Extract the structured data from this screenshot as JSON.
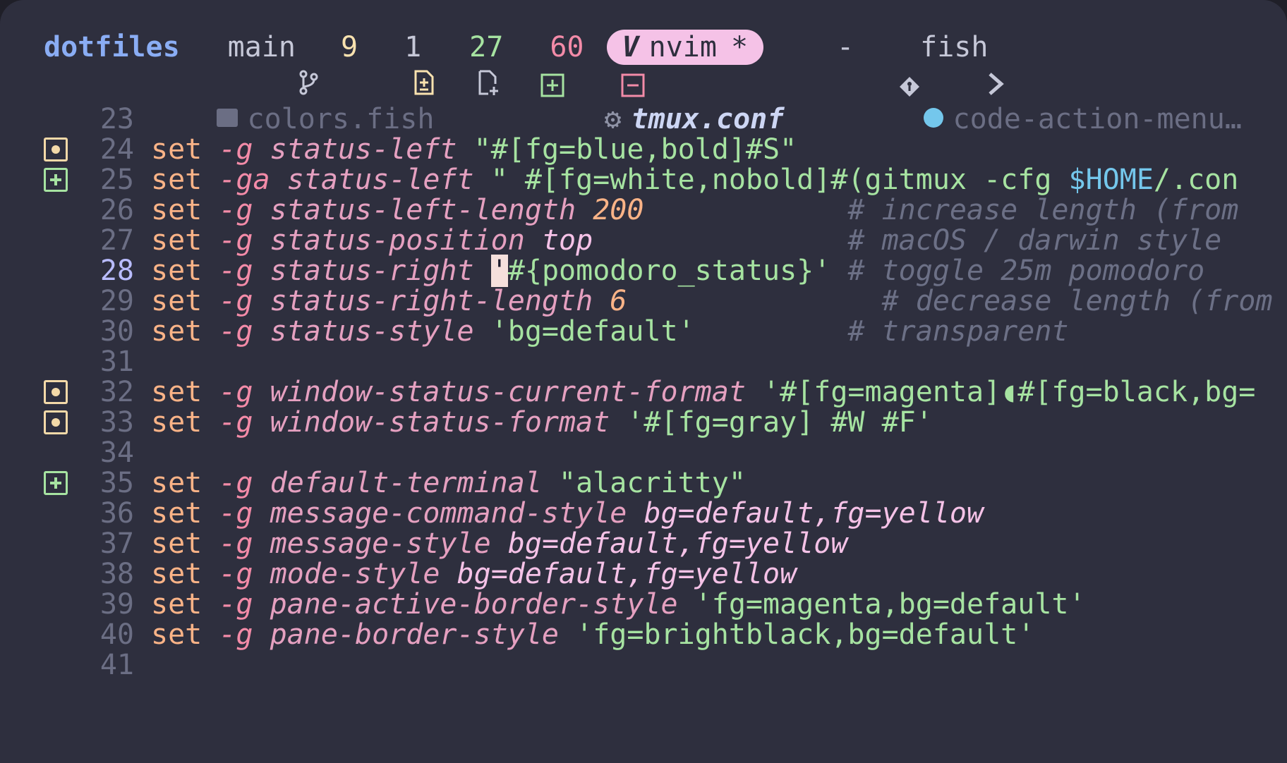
{
  "status": {
    "repo": "dotfiles",
    "branch": "main",
    "staged": "9",
    "untracked": "1",
    "added": "27",
    "removed": "60",
    "mode": "nvim",
    "mode_flag": "*",
    "git_sep": "-",
    "shell": "fish"
  },
  "tabs": [
    {
      "label": "colors.fish",
      "icon": "terminal-icon"
    },
    {
      "label": "tmux.conf",
      "icon": "gear-icon"
    },
    {
      "label": "code-action-menu…",
      "icon": "lua-icon"
    }
  ],
  "colors": {
    "background": "#2e2f3e",
    "keyword": "#fab387",
    "option": "#f38ba8",
    "string": "#a6e3a1",
    "comment": "#6c7086",
    "accent": "#f5c2e7"
  },
  "lines": [
    {
      "n": "23",
      "tokens": []
    },
    {
      "n": "24",
      "mark": "mod",
      "tokens": [
        [
          "kw",
          "set"
        ],
        [
          "t",
          " "
        ],
        [
          "fl",
          "-g"
        ],
        [
          "t",
          " "
        ],
        [
          "opt",
          "status-left"
        ],
        [
          "t",
          " "
        ],
        [
          "str",
          "\"#[fg=blue,bold]#S\""
        ]
      ]
    },
    {
      "n": "25",
      "mark": "add",
      "tokens": [
        [
          "kw",
          "set"
        ],
        [
          "t",
          " "
        ],
        [
          "fl",
          "-ga"
        ],
        [
          "t",
          " "
        ],
        [
          "opt",
          "status-left"
        ],
        [
          "t",
          " "
        ],
        [
          "str",
          "\" #[fg=white,nobold]#(gitmux -cfg "
        ],
        [
          "var",
          "$HOME"
        ],
        [
          "str",
          "/.con"
        ]
      ]
    },
    {
      "n": "26",
      "tokens": [
        [
          "kw",
          "set"
        ],
        [
          "t",
          " "
        ],
        [
          "fl",
          "-g"
        ],
        [
          "t",
          " "
        ],
        [
          "opt",
          "status-left-length"
        ],
        [
          "t",
          " "
        ],
        [
          "num",
          "200"
        ],
        [
          "t",
          "            "
        ],
        [
          "cmt",
          "# increase length (from"
        ]
      ]
    },
    {
      "n": "27",
      "tokens": [
        [
          "kw",
          "set"
        ],
        [
          "t",
          " "
        ],
        [
          "fl",
          "-g"
        ],
        [
          "t",
          " "
        ],
        [
          "opt",
          "status-position"
        ],
        [
          "t",
          " "
        ],
        [
          "val",
          "top"
        ],
        [
          "t",
          "               "
        ],
        [
          "cmt",
          "# macOS / darwin style"
        ]
      ]
    },
    {
      "n": "28",
      "current": true,
      "tokens": [
        [
          "kw",
          "set"
        ],
        [
          "t",
          " "
        ],
        [
          "fl",
          "-g"
        ],
        [
          "t",
          " "
        ],
        [
          "opt",
          "status-right"
        ],
        [
          "t",
          " "
        ],
        [
          "cur",
          "'"
        ],
        [
          "str",
          "#{pomodoro_status}'"
        ],
        [
          "t",
          " "
        ],
        [
          "cmt",
          "# toggle 25m pomodoro"
        ]
      ]
    },
    {
      "n": "29",
      "tokens": [
        [
          "kw",
          "set"
        ],
        [
          "t",
          " "
        ],
        [
          "fl",
          "-g"
        ],
        [
          "t",
          " "
        ],
        [
          "opt",
          "status-right-length"
        ],
        [
          "t",
          " "
        ],
        [
          "num",
          "6"
        ],
        [
          "t",
          "               "
        ],
        [
          "cmt",
          "# decrease length (from"
        ]
      ]
    },
    {
      "n": "30",
      "tokens": [
        [
          "kw",
          "set"
        ],
        [
          "t",
          " "
        ],
        [
          "fl",
          "-g"
        ],
        [
          "t",
          " "
        ],
        [
          "opt",
          "status-style"
        ],
        [
          "t",
          " "
        ],
        [
          "str",
          "'bg=default'"
        ],
        [
          "t",
          "         "
        ],
        [
          "cmt",
          "# transparent"
        ]
      ]
    },
    {
      "n": "31",
      "tokens": []
    },
    {
      "n": "32",
      "mark": "mod",
      "tokens": [
        [
          "kw",
          "set"
        ],
        [
          "t",
          " "
        ],
        [
          "fl",
          "-g"
        ],
        [
          "t",
          " "
        ],
        [
          "opt",
          "window-status-current-format"
        ],
        [
          "t",
          " "
        ],
        [
          "str",
          "'#[fg=magenta]◖#[fg=black,bg="
        ]
      ]
    },
    {
      "n": "33",
      "mark": "mod",
      "tokens": [
        [
          "kw",
          "set"
        ],
        [
          "t",
          " "
        ],
        [
          "fl",
          "-g"
        ],
        [
          "t",
          " "
        ],
        [
          "opt",
          "window-status-format"
        ],
        [
          "t",
          " "
        ],
        [
          "str",
          "'#[fg=gray] #W #F'"
        ]
      ]
    },
    {
      "n": "34",
      "tokens": []
    },
    {
      "n": "35",
      "mark": "add",
      "tokens": [
        [
          "kw",
          "set"
        ],
        [
          "t",
          " "
        ],
        [
          "fl",
          "-g"
        ],
        [
          "t",
          " "
        ],
        [
          "opt",
          "default-terminal"
        ],
        [
          "t",
          " "
        ],
        [
          "str",
          "\"alacritty\""
        ]
      ]
    },
    {
      "n": "36",
      "tokens": [
        [
          "kw",
          "set"
        ],
        [
          "t",
          " "
        ],
        [
          "fl",
          "-g"
        ],
        [
          "t",
          " "
        ],
        [
          "opt",
          "message-command-style"
        ],
        [
          "t",
          " "
        ],
        [
          "val",
          "bg=default,fg=yellow"
        ]
      ]
    },
    {
      "n": "37",
      "tokens": [
        [
          "kw",
          "set"
        ],
        [
          "t",
          " "
        ],
        [
          "fl",
          "-g"
        ],
        [
          "t",
          " "
        ],
        [
          "opt",
          "message-style"
        ],
        [
          "t",
          " "
        ],
        [
          "val",
          "bg=default,fg=yellow"
        ]
      ]
    },
    {
      "n": "38",
      "tokens": [
        [
          "kw",
          "set"
        ],
        [
          "t",
          " "
        ],
        [
          "fl",
          "-g"
        ],
        [
          "t",
          " "
        ],
        [
          "opt",
          "mode-style"
        ],
        [
          "t",
          " "
        ],
        [
          "val",
          "bg=default,fg=yellow"
        ]
      ]
    },
    {
      "n": "39",
      "tokens": [
        [
          "kw",
          "set"
        ],
        [
          "t",
          " "
        ],
        [
          "fl",
          "-g"
        ],
        [
          "t",
          " "
        ],
        [
          "opt",
          "pane-active-border-style"
        ],
        [
          "t",
          " "
        ],
        [
          "str",
          "'fg=magenta,bg=default'"
        ]
      ]
    },
    {
      "n": "40",
      "tokens": [
        [
          "kw",
          "set"
        ],
        [
          "t",
          " "
        ],
        [
          "fl",
          "-g"
        ],
        [
          "t",
          " "
        ],
        [
          "opt",
          "pane-border-style"
        ],
        [
          "t",
          " "
        ],
        [
          "str",
          "'fg=brightblack,bg=default'"
        ]
      ]
    },
    {
      "n": "41",
      "tokens": []
    }
  ]
}
